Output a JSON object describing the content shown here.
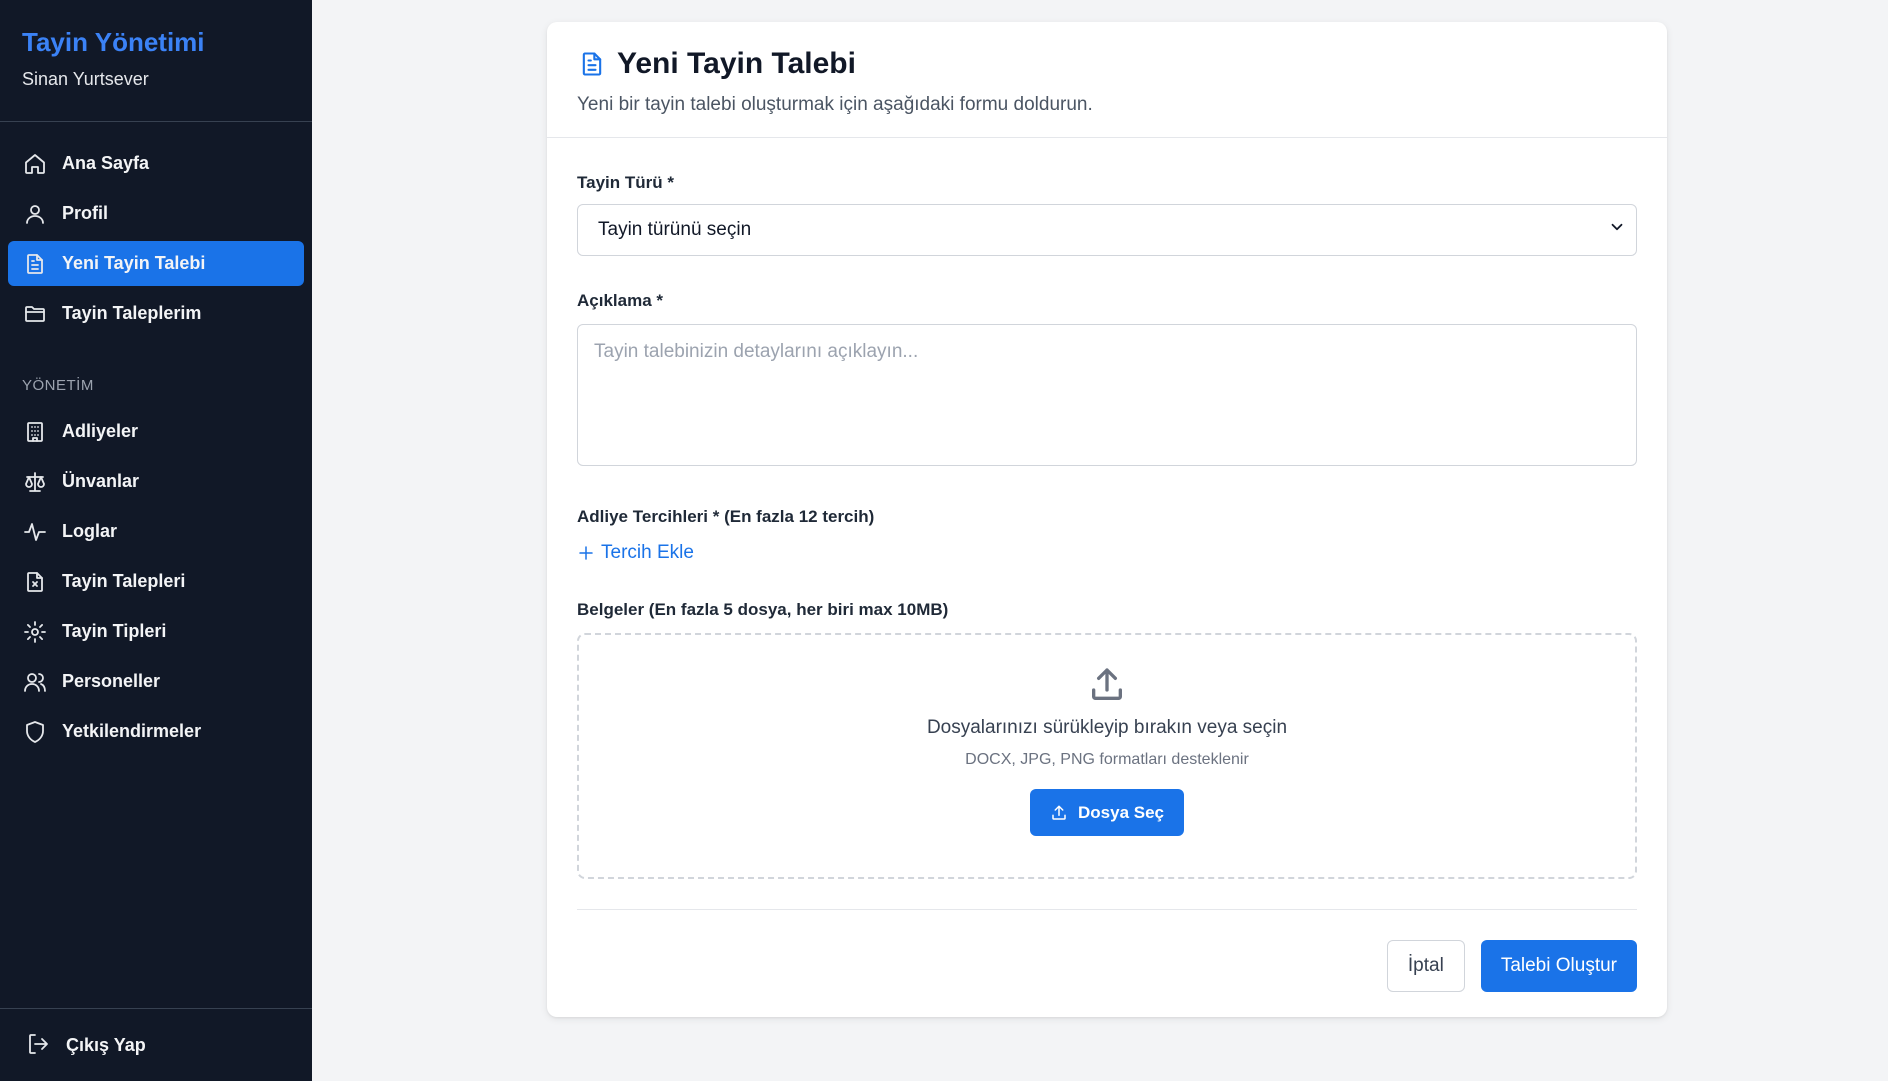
{
  "sidebar": {
    "brand_title": "Tayin Yönetimi",
    "user_name": "Sinan Yurtsever",
    "main_items": [
      {
        "label": "Ana Sayfa",
        "icon": "home-icon"
      },
      {
        "label": "Profil",
        "icon": "user-icon"
      },
      {
        "label": "Yeni Tayin Talebi",
        "icon": "document-icon",
        "active": true
      },
      {
        "label": "Tayin Taleplerim",
        "icon": "folder-icon"
      }
    ],
    "section_label": "YÖNETİM",
    "admin_items": [
      {
        "label": "Adliyeler",
        "icon": "building-icon"
      },
      {
        "label": "Ünvanlar",
        "icon": "scale-icon"
      },
      {
        "label": "Loglar",
        "icon": "activity-icon"
      },
      {
        "label": "Tayin Talepleri",
        "icon": "file-x-icon"
      },
      {
        "label": "Tayin Tipleri",
        "icon": "gear-icon"
      },
      {
        "label": "Personeller",
        "icon": "users-icon"
      },
      {
        "label": "Yetkilendirmeler",
        "icon": "shield-icon"
      }
    ],
    "logout_label": "Çıkış Yap"
  },
  "form": {
    "title": "Yeni Tayin Talebi",
    "subtitle": "Yeni bir tayin talebi oluşturmak için aşağıdaki formu doldurun.",
    "type_label": "Tayin Türü *",
    "type_value": "Tayin türünü seçin",
    "description_label": "Açıklama *",
    "description_placeholder": "Tayin talebinizin detaylarını açıklayın...",
    "description_value": "",
    "preferences_label": "Adliye Tercihleri * (En fazla 12 tercih)",
    "add_preference_label": "Tercih Ekle",
    "documents_label": "Belgeler (En fazla 5 dosya, her biri max 10MB)",
    "dropzone_title": "Dosyalarınızı sürükleyip bırakın veya seçin",
    "dropzone_subtitle": "DOCX, JPG, PNG formatları desteklenir",
    "choose_file_label": "Dosya Seç",
    "cancel_label": "İptal",
    "submit_label": "Talebi Oluştur"
  },
  "colors": {
    "accent": "#1a73e8",
    "sidebar_bg": "#111827",
    "page_bg": "#f3f4f6"
  }
}
